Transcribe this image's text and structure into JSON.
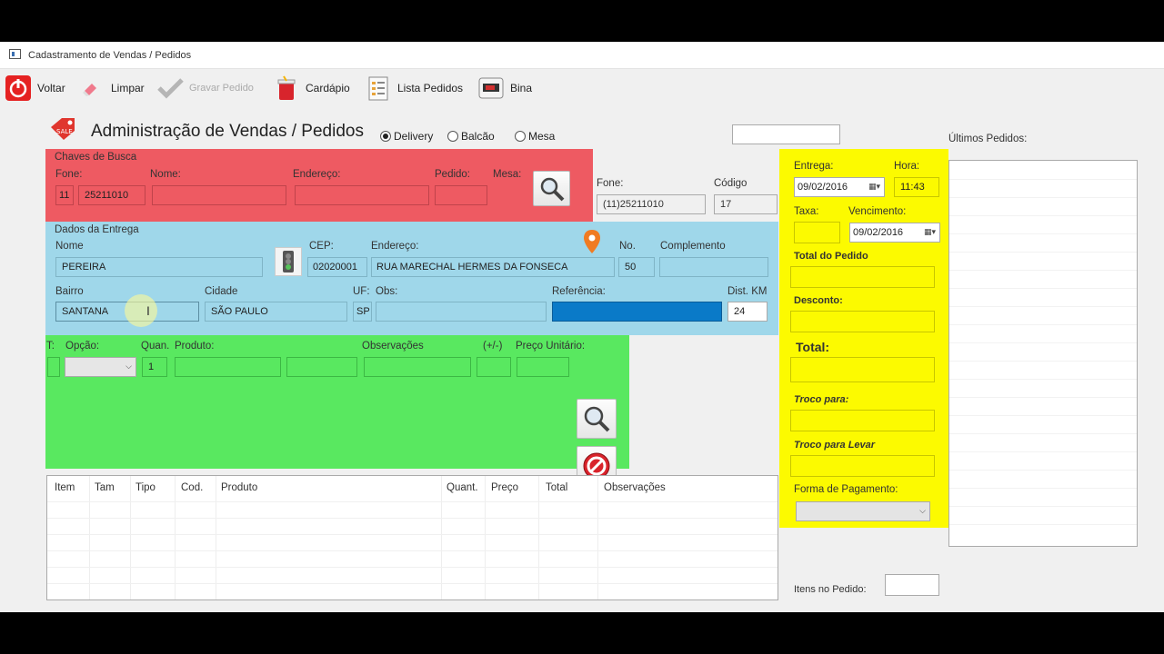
{
  "window": {
    "title": "Cadastramento de Vendas / Pedidos"
  },
  "toolbar": {
    "voltar": "Voltar",
    "limpar": "Limpar",
    "gravar": "Gravar Pedido",
    "cardapio": "Cardápio",
    "lista": "Lista Pedidos",
    "bina": "Bina"
  },
  "header": {
    "title": "Administração de Vendas / Pedidos",
    "modes": [
      "Delivery",
      "Balcão",
      "Mesa"
    ],
    "selected_mode": "Delivery"
  },
  "busca": {
    "legend": "Chaves de Busca",
    "fone_label": "Fone:",
    "ddd": "11",
    "fone": "25211010",
    "nome_label": "Nome:",
    "endereco_label": "Endereço:",
    "pedido_label": "Pedido:",
    "mesa_label": "Mesa:"
  },
  "cliente": {
    "fone_label": "Fone:",
    "fone": "(11)25211010",
    "codigo_label": "Código",
    "codigo": "17"
  },
  "entrega": {
    "legend": "Dados da Entrega",
    "nome_label": "Nome",
    "nome": "PEREIRA",
    "cep_label": "CEP:",
    "cep": "02020001",
    "endereco_label": "Endereço:",
    "endereco": "RUA MARECHAL HERMES DA FONSECA",
    "no_label": "No.",
    "no": "50",
    "complemento_label": "Complemento",
    "bairro_label": "Bairro",
    "bairro": "SANTANA",
    "cidade_label": "Cidade",
    "cidade": "SÃO PAULO",
    "uf_label": "UF:",
    "uf": "SP",
    "obs_label": "Obs:",
    "referencia_label": "Referência:",
    "dist_label": "Dist. KM",
    "dist": "24"
  },
  "produto": {
    "t_label": "T:",
    "opcao_label": "Opção:",
    "quan_label": "Quan.",
    "quan": "1",
    "produto_label": "Produto:",
    "observacoes_label": "Observações",
    "maismenos_label": "(+/-)",
    "preco_label": "Preço Unitário:"
  },
  "grid": {
    "columns": [
      "Item",
      "Tam",
      "Tipo",
      "Cod.",
      "Produto",
      "Quant.",
      "Preço",
      "Total",
      "Observações"
    ]
  },
  "resumo": {
    "entrega_label": "Entrega:",
    "entrega_data": "09/02/2016",
    "hora_label": "Hora:",
    "hora": "11:43",
    "taxa_label": "Taxa:",
    "vencimento_label": "Vencimento:",
    "vencimento": "09/02/2016",
    "total_pedido_label": "Total do Pedido",
    "desconto_label": "Desconto:",
    "total_label": "Total:",
    "troco_label": "Troco para:",
    "troco_levar_label": "Troco para Levar",
    "forma_pagamento_label": "Forma de Pagamento:"
  },
  "ultimos": {
    "label": "Últimos Pedidos:"
  },
  "footer": {
    "itens_label": "Itens no Pedido:"
  },
  "colors": {
    "search_keys": "#ee5a62",
    "delivery": "#9fd7ea",
    "product": "#59e860",
    "summary": "#fcfa00",
    "referencia_highlight": "#0a7ac8"
  }
}
